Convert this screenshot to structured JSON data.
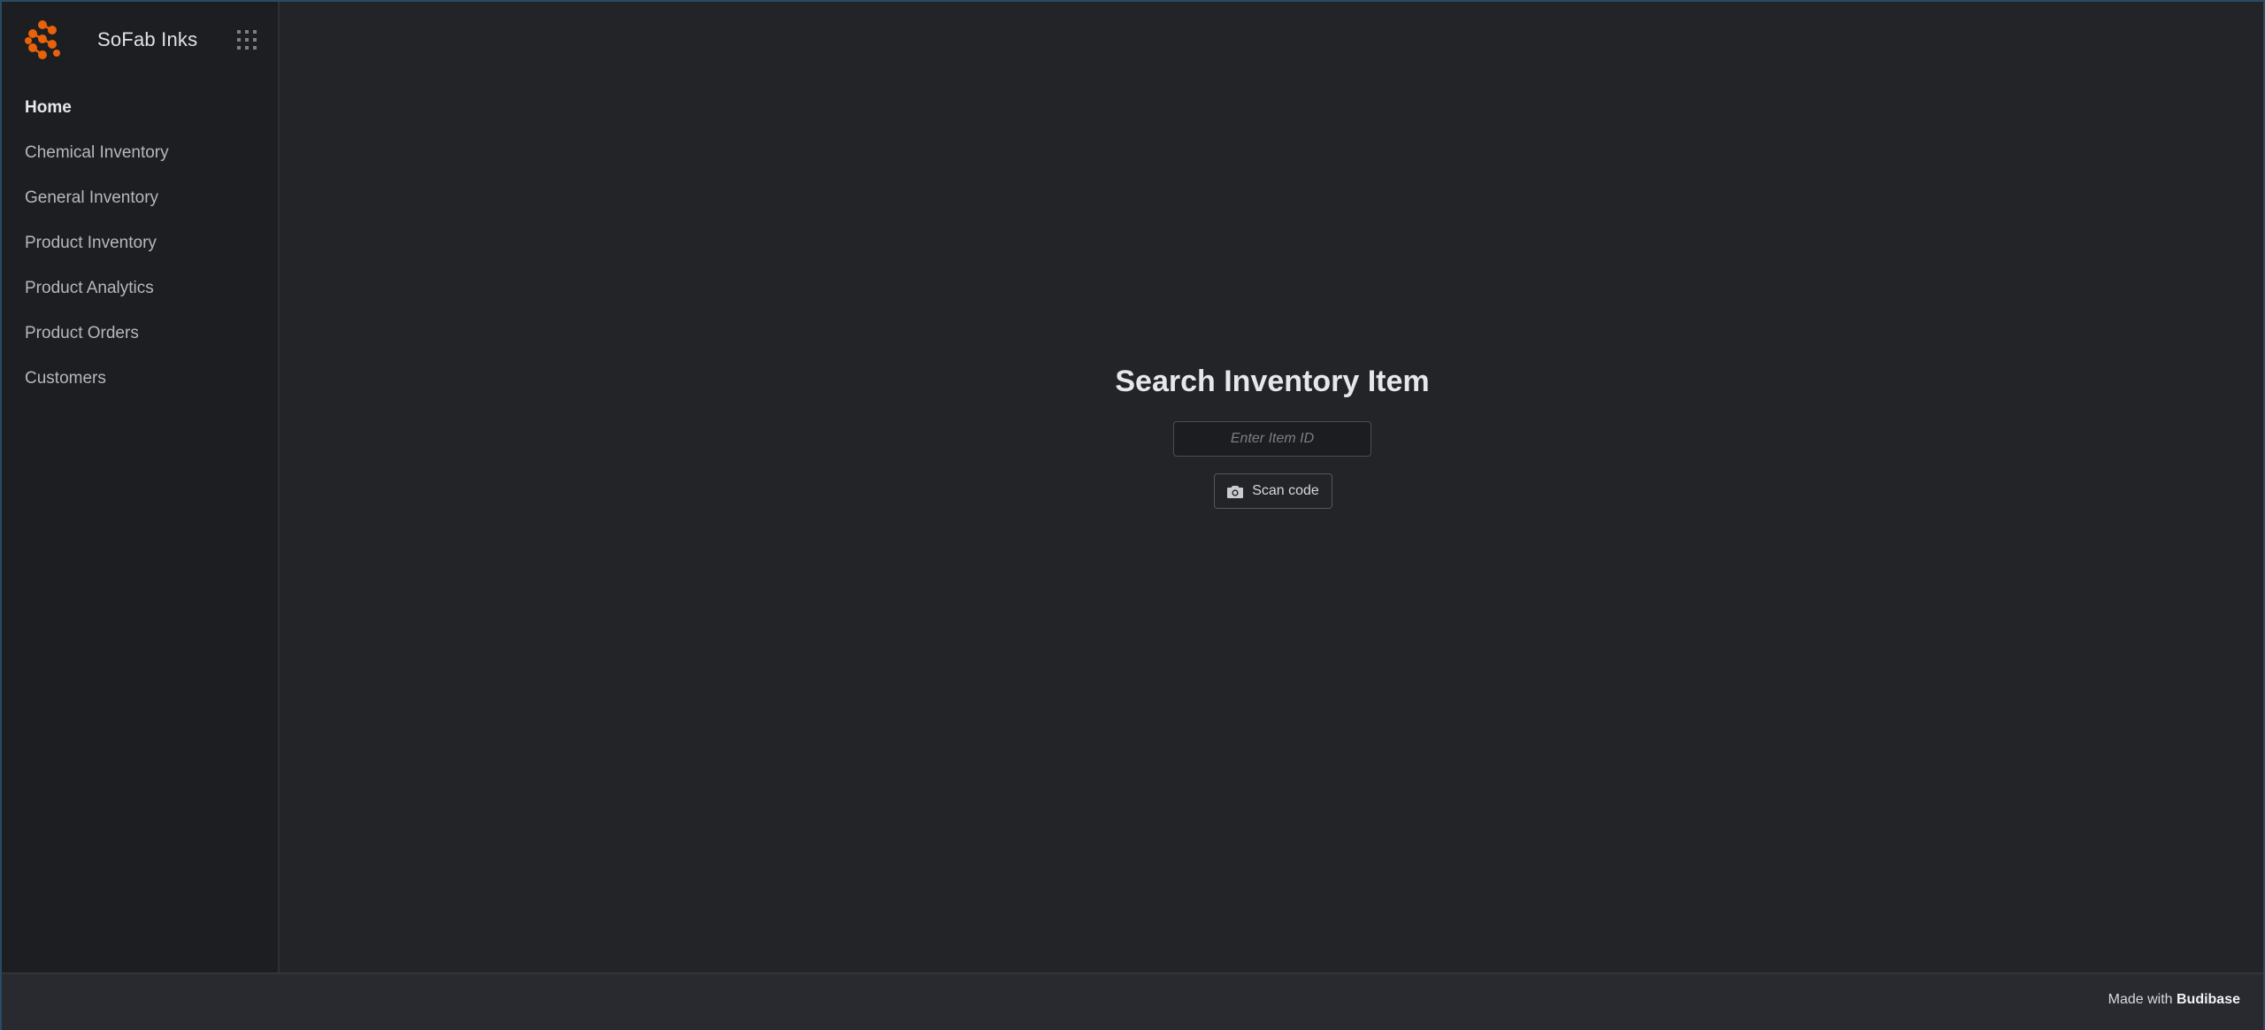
{
  "app": {
    "name": "SoFab Inks",
    "logo_icon": "hex-cluster-logo-icon",
    "apps_icon": "grid-dots-icon",
    "brand_color": "#e8620a"
  },
  "sidebar": {
    "items": [
      {
        "label": "Home",
        "active": true
      },
      {
        "label": "Chemical Inventory",
        "active": false
      },
      {
        "label": "General Inventory",
        "active": false
      },
      {
        "label": "Product Inventory",
        "active": false
      },
      {
        "label": "Product Analytics",
        "active": false
      },
      {
        "label": "Product Orders",
        "active": false
      },
      {
        "label": "Customers",
        "active": false
      }
    ]
  },
  "main": {
    "title": "Search Inventory Item",
    "item_input": {
      "placeholder": "Enter Item ID",
      "value": ""
    },
    "scan_button": {
      "label": "Scan code",
      "icon": "camera-icon"
    }
  },
  "footer": {
    "made_with": "Made with",
    "brand": "Budibase"
  }
}
